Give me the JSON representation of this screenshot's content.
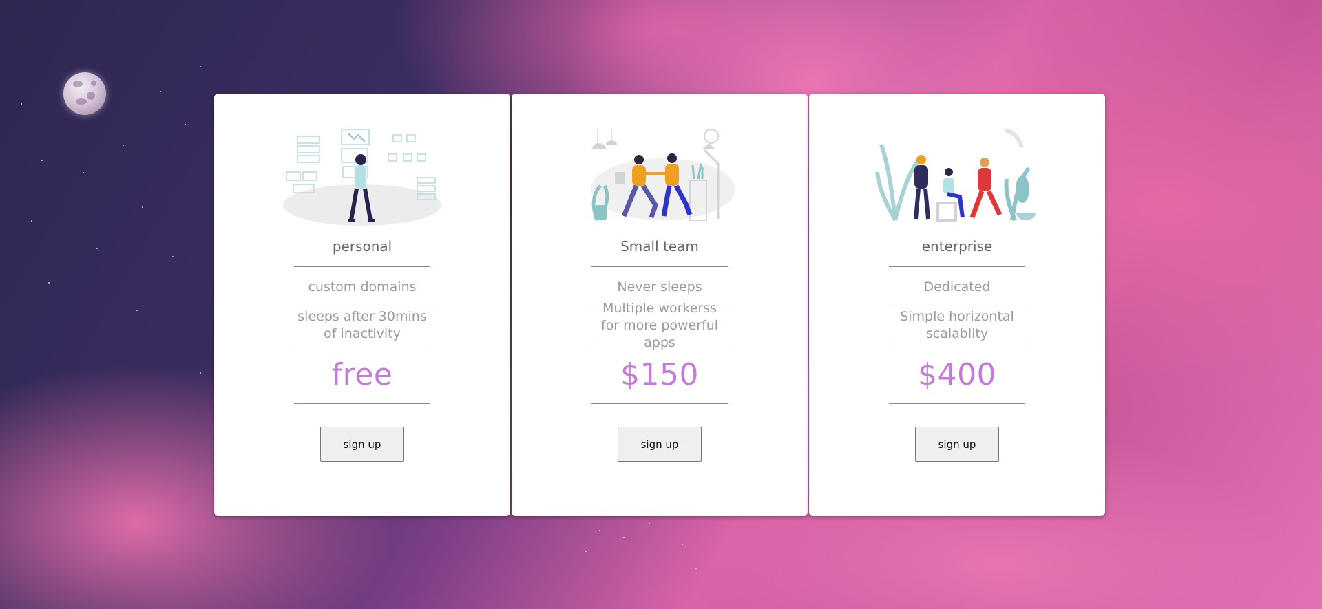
{
  "plans": [
    {
      "name": "personal",
      "feature1": "custom domains",
      "feature2": "sleeps after 30mins of inactivity",
      "price": "free",
      "button": "sign up"
    },
    {
      "name": "Small team",
      "feature1": "Never sleeps",
      "feature2": "Multiple workerss for more powerful apps",
      "price": "$150",
      "button": "sign up"
    },
    {
      "name": "enterprise",
      "feature1": "Dedicated",
      "feature2": "Simple horizontal scalablity",
      "price": "$400",
      "button": "sign up"
    }
  ],
  "colors": {
    "price": "#c47ad8",
    "background_dark": "#2e2752",
    "background_pink": "#e173b2"
  }
}
